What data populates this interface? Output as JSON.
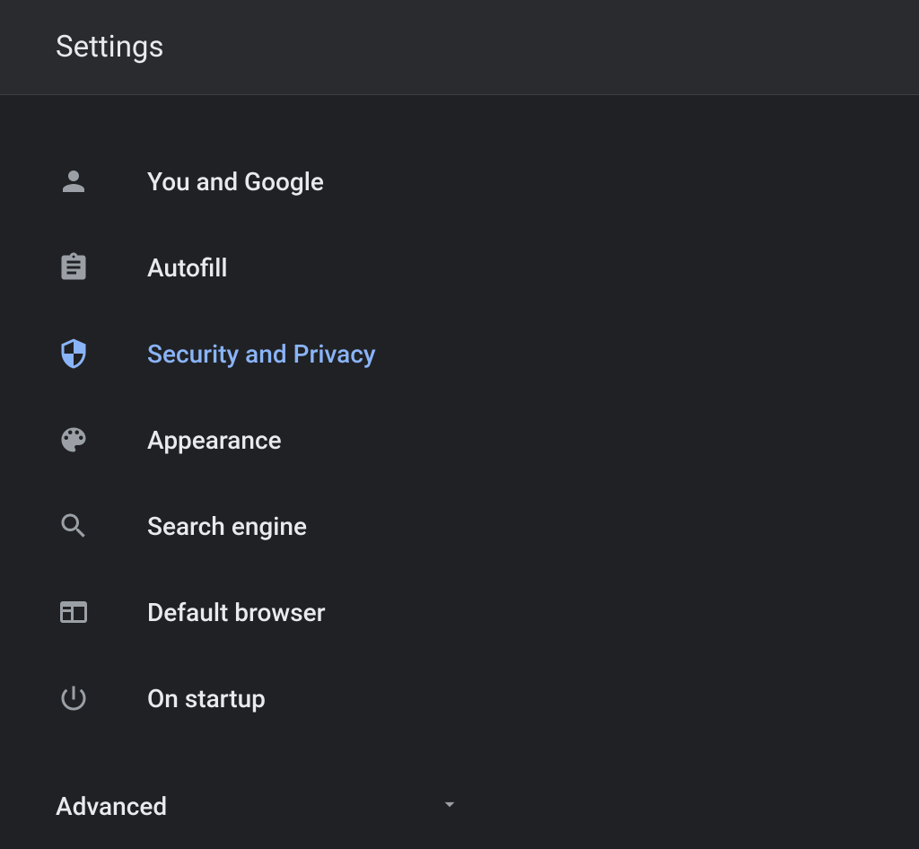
{
  "header": {
    "title": "Settings"
  },
  "sidebar": {
    "items": [
      {
        "label": "You and Google",
        "icon": "person-icon",
        "active": false
      },
      {
        "label": "Autofill",
        "icon": "clipboard-icon",
        "active": false
      },
      {
        "label": "Security and Privacy",
        "icon": "shield-icon",
        "active": true
      },
      {
        "label": "Appearance",
        "icon": "palette-icon",
        "active": false
      },
      {
        "label": "Search engine",
        "icon": "search-icon",
        "active": false
      },
      {
        "label": "Default browser",
        "icon": "browser-icon",
        "active": false
      },
      {
        "label": "On startup",
        "icon": "power-icon",
        "active": false
      }
    ],
    "advanced": {
      "label": "Advanced"
    }
  },
  "colors": {
    "background": "#202124",
    "headerBackground": "#2a2b2e",
    "text": "#e8eaed",
    "iconDefault": "#9aa0a6",
    "accent": "#8ab4f8",
    "divider": "#3c4043"
  }
}
